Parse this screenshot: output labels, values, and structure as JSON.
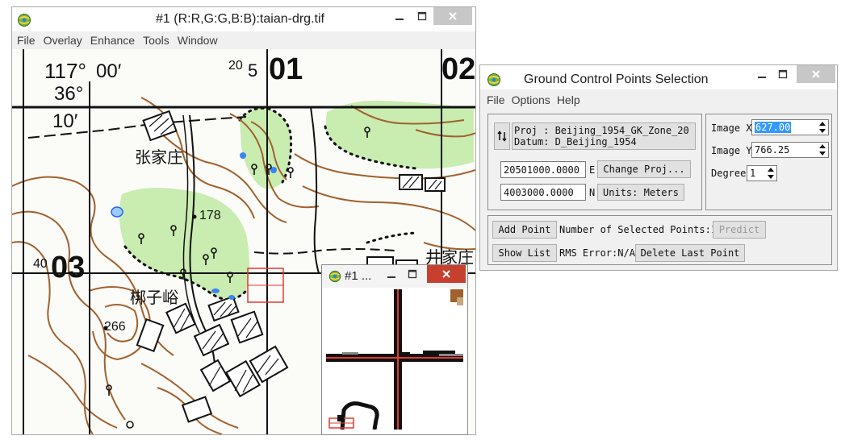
{
  "main_window": {
    "title": "#1 (R:R,G:G,B:B):taian-drg.tif",
    "menu": [
      "File",
      "Overlay",
      "Enhance",
      "Tools",
      "Window"
    ]
  },
  "map_labels": {
    "lon_deg": "117°",
    "lon_min": "00′",
    "lat_deg": "36°",
    "lat_min": "10′",
    "grid_top_small": "20",
    "grid_top_5": "5",
    "grid_top_01": "01",
    "grid_top_02": "02",
    "grid_left_small": "40",
    "grid_left_03": "03",
    "village_zhangjiazhuang": "张家庄",
    "village_jingjiazhuang": "井家庄",
    "village_banziyu": "梆子峪",
    "elev_178": "178",
    "elev_266": "266"
  },
  "zoom_window": {
    "title": "#1 ..."
  },
  "gcp_window": {
    "title": "Ground Control Points Selection",
    "menu": [
      "File",
      "Options",
      "Help"
    ],
    "proj_line": "Proj : Beijing_1954_GK_Zone_20",
    "datum_line": "Datum: D_Beijing_1954",
    "easting_value": "20501000.0000",
    "easting_unit": "E",
    "northing_value": "4003000.0000",
    "northing_unit": "N",
    "change_proj_label": "Change Proj...",
    "units_label": "Units: Meters",
    "image_x_label": "Image X",
    "image_x_value": "627.00",
    "image_y_label": "Image Y",
    "image_y_value": "766.25",
    "degree_label": "Degree",
    "degree_value": "1",
    "add_point_label": "Add Point",
    "selected_points_text": "Number of Selected Points:1",
    "predict_label": "Predict",
    "show_list_label": "Show List",
    "rms_text": "RMS Error:N/A",
    "delete_last_label": "Delete Last Point"
  },
  "colors": {
    "contour": "#a0612e",
    "vegetation": "#c9ecb0",
    "grid": "#111111",
    "cursor_box": "#e23b2e",
    "selection": "#3399ff"
  }
}
